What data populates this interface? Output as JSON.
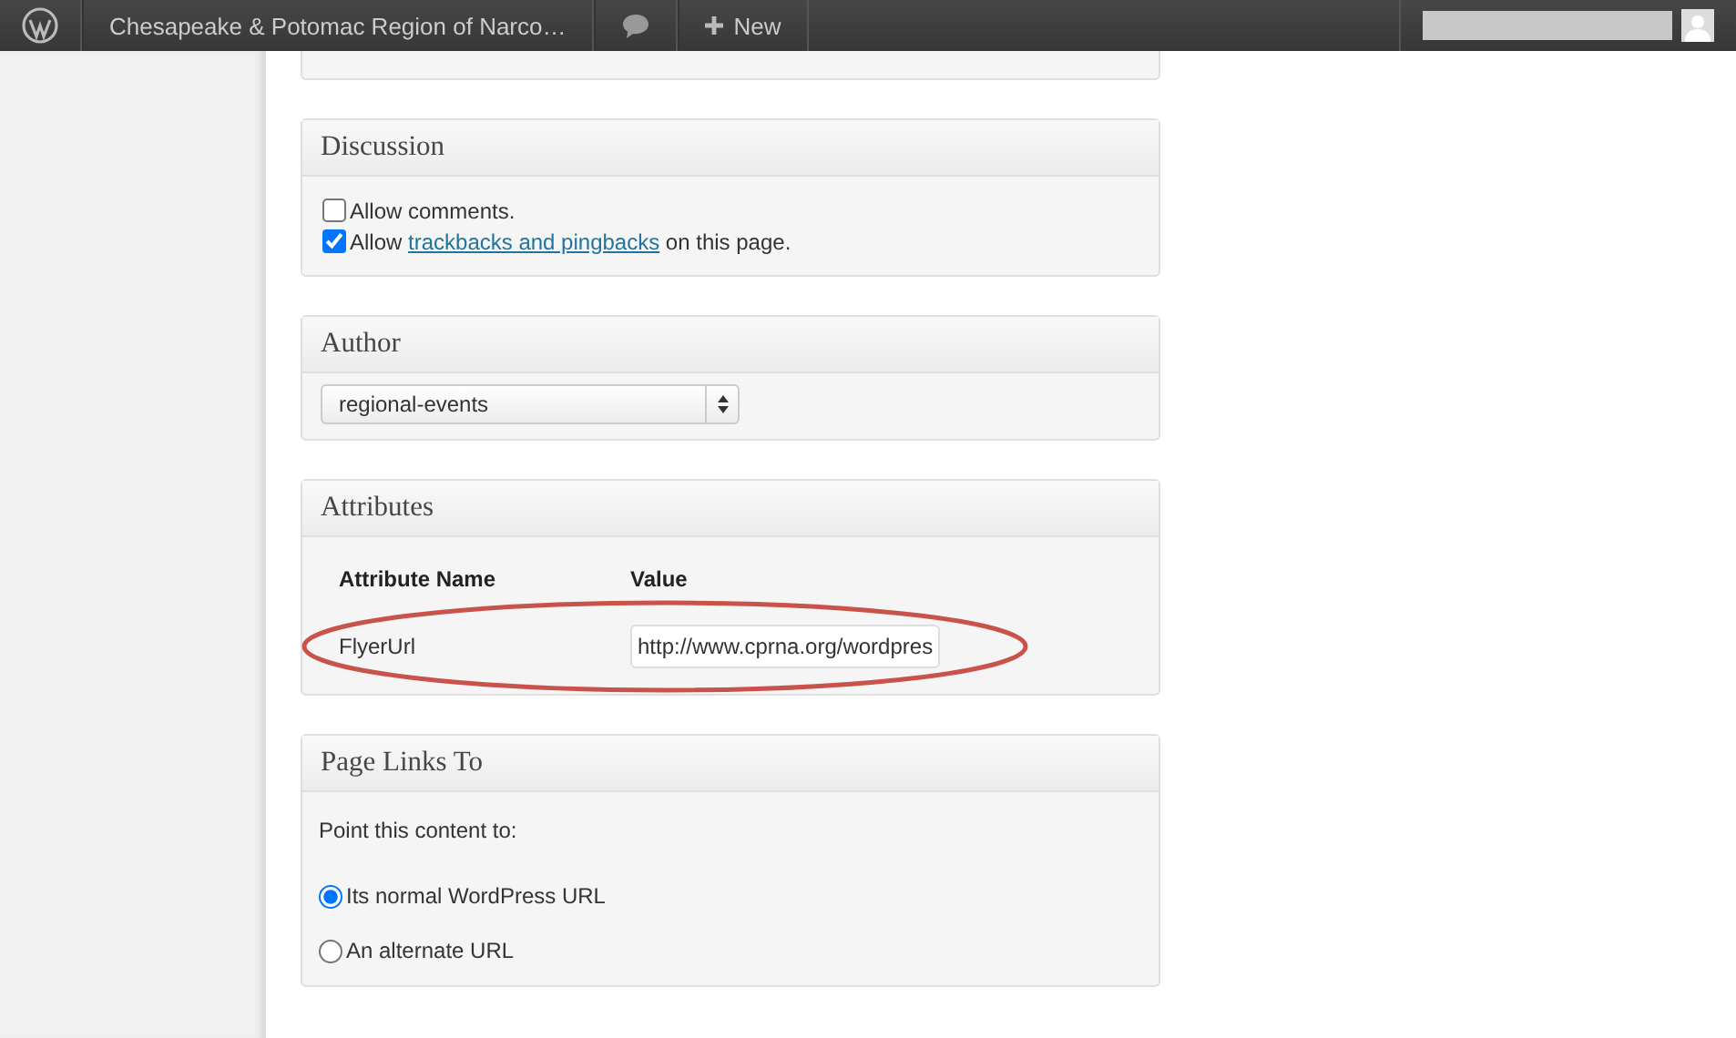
{
  "admin_bar": {
    "site_title": "Chesapeake & Potomac Region of Narco…",
    "new_label": "New"
  },
  "discussion": {
    "title": "Discussion",
    "options": [
      {
        "kind": "plain",
        "text": "Allow comments.",
        "checked": false
      },
      {
        "kind": "link",
        "before": "Allow ",
        "link": "trackbacks and pingbacks",
        "after": " on this page.",
        "checked": true
      }
    ]
  },
  "author": {
    "title": "Author",
    "value": "regional-events"
  },
  "attributes": {
    "title": "Attributes",
    "columns": [
      "Attribute Name",
      "Value"
    ],
    "rows": [
      {
        "name": "FlyerUrl",
        "value": "http://www.cprna.org/wordpres"
      }
    ]
  },
  "page_links": {
    "title": "Page Links To",
    "prompt": "Point this content to:",
    "options": [
      {
        "label": "Its normal WordPress URL",
        "selected": true
      },
      {
        "label": "An alternate URL",
        "selected": false
      }
    ]
  }
}
